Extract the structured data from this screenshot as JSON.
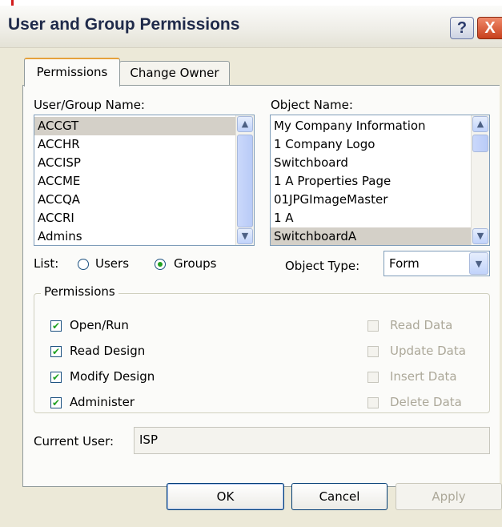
{
  "window": {
    "title": "User and Group Permissions",
    "help_label": "?",
    "close_label": "X"
  },
  "tabs": [
    {
      "label": "Permissions",
      "active": true
    },
    {
      "label": "Change Owner",
      "active": false
    }
  ],
  "user_group": {
    "label": "User/Group Name:",
    "items": [
      "ACCGT",
      "ACCHR",
      "ACCISP",
      "ACCME",
      "ACCQA",
      "ACCRI",
      "Admins"
    ],
    "selected": "ACCGT"
  },
  "object_name": {
    "label": "Object Name:",
    "items": [
      "My Company Information",
      "1 Company Logo",
      "Switchboard",
      "1 A Properties Page",
      "01JPGImageMaster",
      "1 A",
      "SwitchboardA"
    ],
    "selected": "SwitchboardA"
  },
  "list_filter": {
    "label": "List:",
    "options": [
      {
        "label": "Users",
        "selected": false
      },
      {
        "label": "Groups",
        "selected": true
      }
    ]
  },
  "object_type": {
    "label": "Object Type:",
    "value": "Form"
  },
  "permissions": {
    "legend": "Permissions",
    "left": [
      {
        "label": "Open/Run",
        "checked": true,
        "enabled": true
      },
      {
        "label": "Read Design",
        "checked": true,
        "enabled": true
      },
      {
        "label": "Modify Design",
        "checked": true,
        "enabled": true
      },
      {
        "label": "Administer",
        "checked": true,
        "enabled": true
      }
    ],
    "right": [
      {
        "label": "Read Data",
        "checked": false,
        "enabled": false
      },
      {
        "label": "Update Data",
        "checked": false,
        "enabled": false
      },
      {
        "label": "Insert Data",
        "checked": false,
        "enabled": false
      },
      {
        "label": "Delete Data",
        "checked": false,
        "enabled": false
      }
    ]
  },
  "current_user": {
    "label": "Current User:",
    "value": "ISP"
  },
  "buttons": {
    "ok": "OK",
    "cancel": "Cancel",
    "apply": "Apply"
  },
  "colors": {
    "accent": "#d21b1b",
    "selection": "#d4d0c8",
    "dialog_bg": "#ece9d8"
  }
}
